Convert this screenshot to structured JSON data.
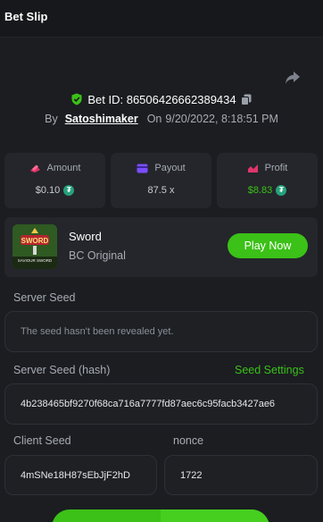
{
  "header": {
    "title": "Bet Slip"
  },
  "bet": {
    "id_label": "Bet ID: 86506426662389434",
    "by_label": "By",
    "user": "Satoshimaker",
    "on_label": "On",
    "datetime": "9/20/2022, 8:18:51 PM"
  },
  "stats": {
    "amount": {
      "label": "Amount",
      "value": "$0.10",
      "icon": "amount-icon"
    },
    "payout": {
      "label": "Payout",
      "value": "87.5 x",
      "icon": "payout-icon"
    },
    "profit": {
      "label": "Profit",
      "value": "$8.83",
      "icon": "profit-icon"
    }
  },
  "game": {
    "name": "Sword",
    "provider": "BC Original",
    "play_label": "Play Now",
    "thumb_title": "SWORD",
    "thumb_subtitle": "SAVIOUR SWORD"
  },
  "server_seed": {
    "label": "Server Seed",
    "value": "The seed hasn't been revealed yet."
  },
  "server_seed_hash": {
    "label": "Server Seed (hash)",
    "settings_label": "Seed Settings",
    "value": "4b238465bf9270f68ca716a7777fd87aec6c95facb3427ae6"
  },
  "client_seed": {
    "label": "Client Seed",
    "value": "4mSNe18H87sEbJjF2hD"
  },
  "nonce": {
    "label": "nonce",
    "value": "1722"
  },
  "colors": {
    "background": "#1b1d21",
    "card": "#24262b",
    "accent_green": "#3bc117",
    "amount_icon": "#e0356b",
    "payout_icon": "#7b4dff",
    "profit_icon": "#e0356b",
    "tether": "#26a17b"
  }
}
